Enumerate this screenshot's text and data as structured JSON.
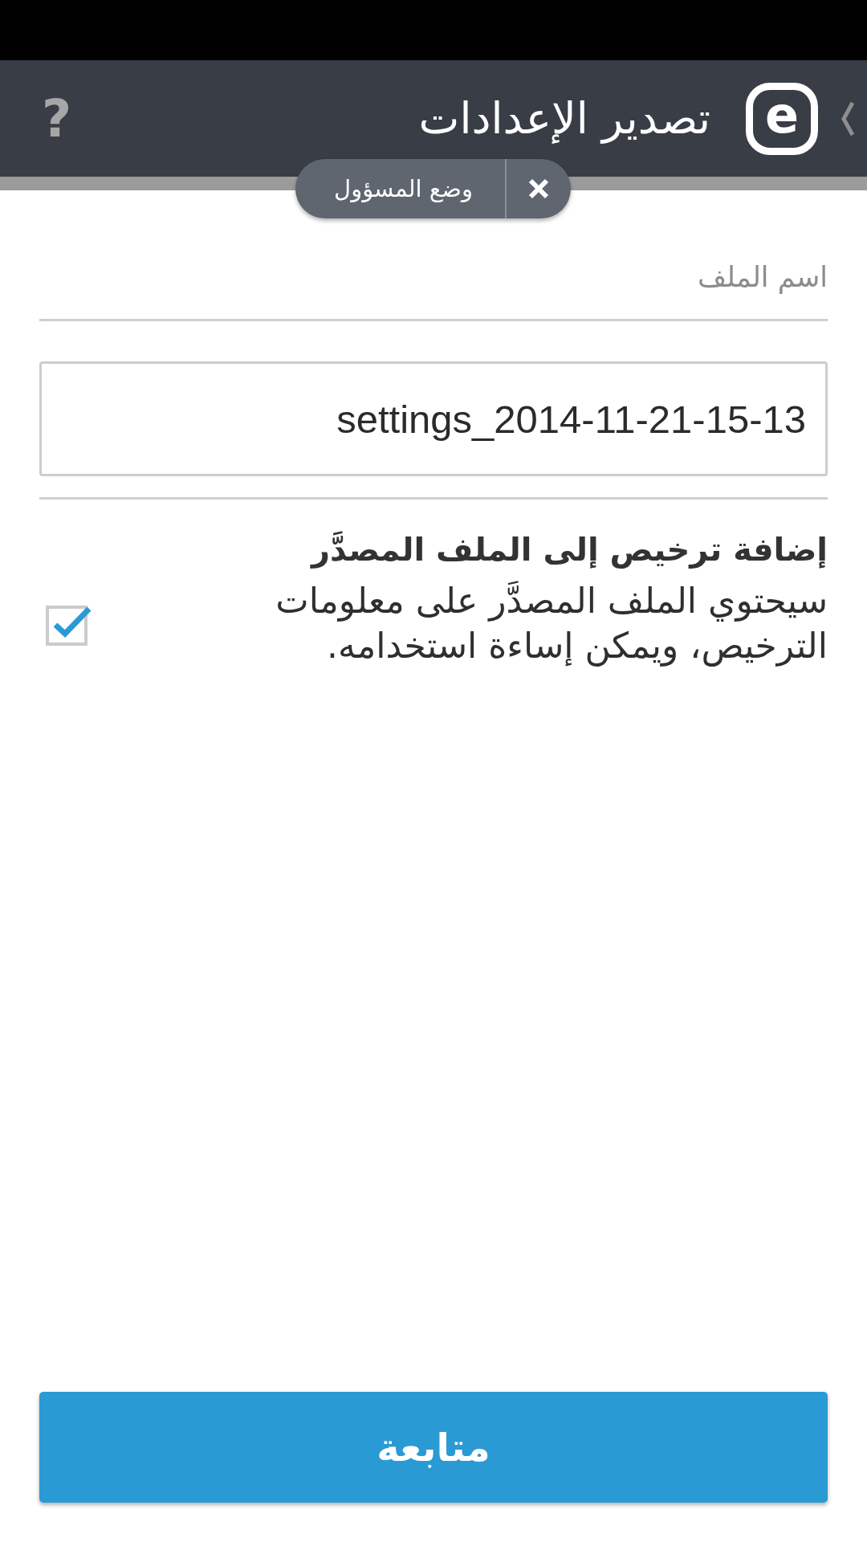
{
  "header": {
    "help": "?",
    "logo": "e",
    "title": "تصدير الإعدادات"
  },
  "mode_badge": {
    "label": "وضع المسؤول"
  },
  "file_name": {
    "label": "اسم الملف",
    "value": "settings_2014-11-21-15-13"
  },
  "license_option": {
    "title": "إضافة ترخيص إلى الملف المصدَّر",
    "description": "سيحتوي الملف المصدَّر على معلومات الترخيص، ويمكن إساءة استخدامه.",
    "checked": true
  },
  "continue_button": {
    "label": "متابعة"
  }
}
